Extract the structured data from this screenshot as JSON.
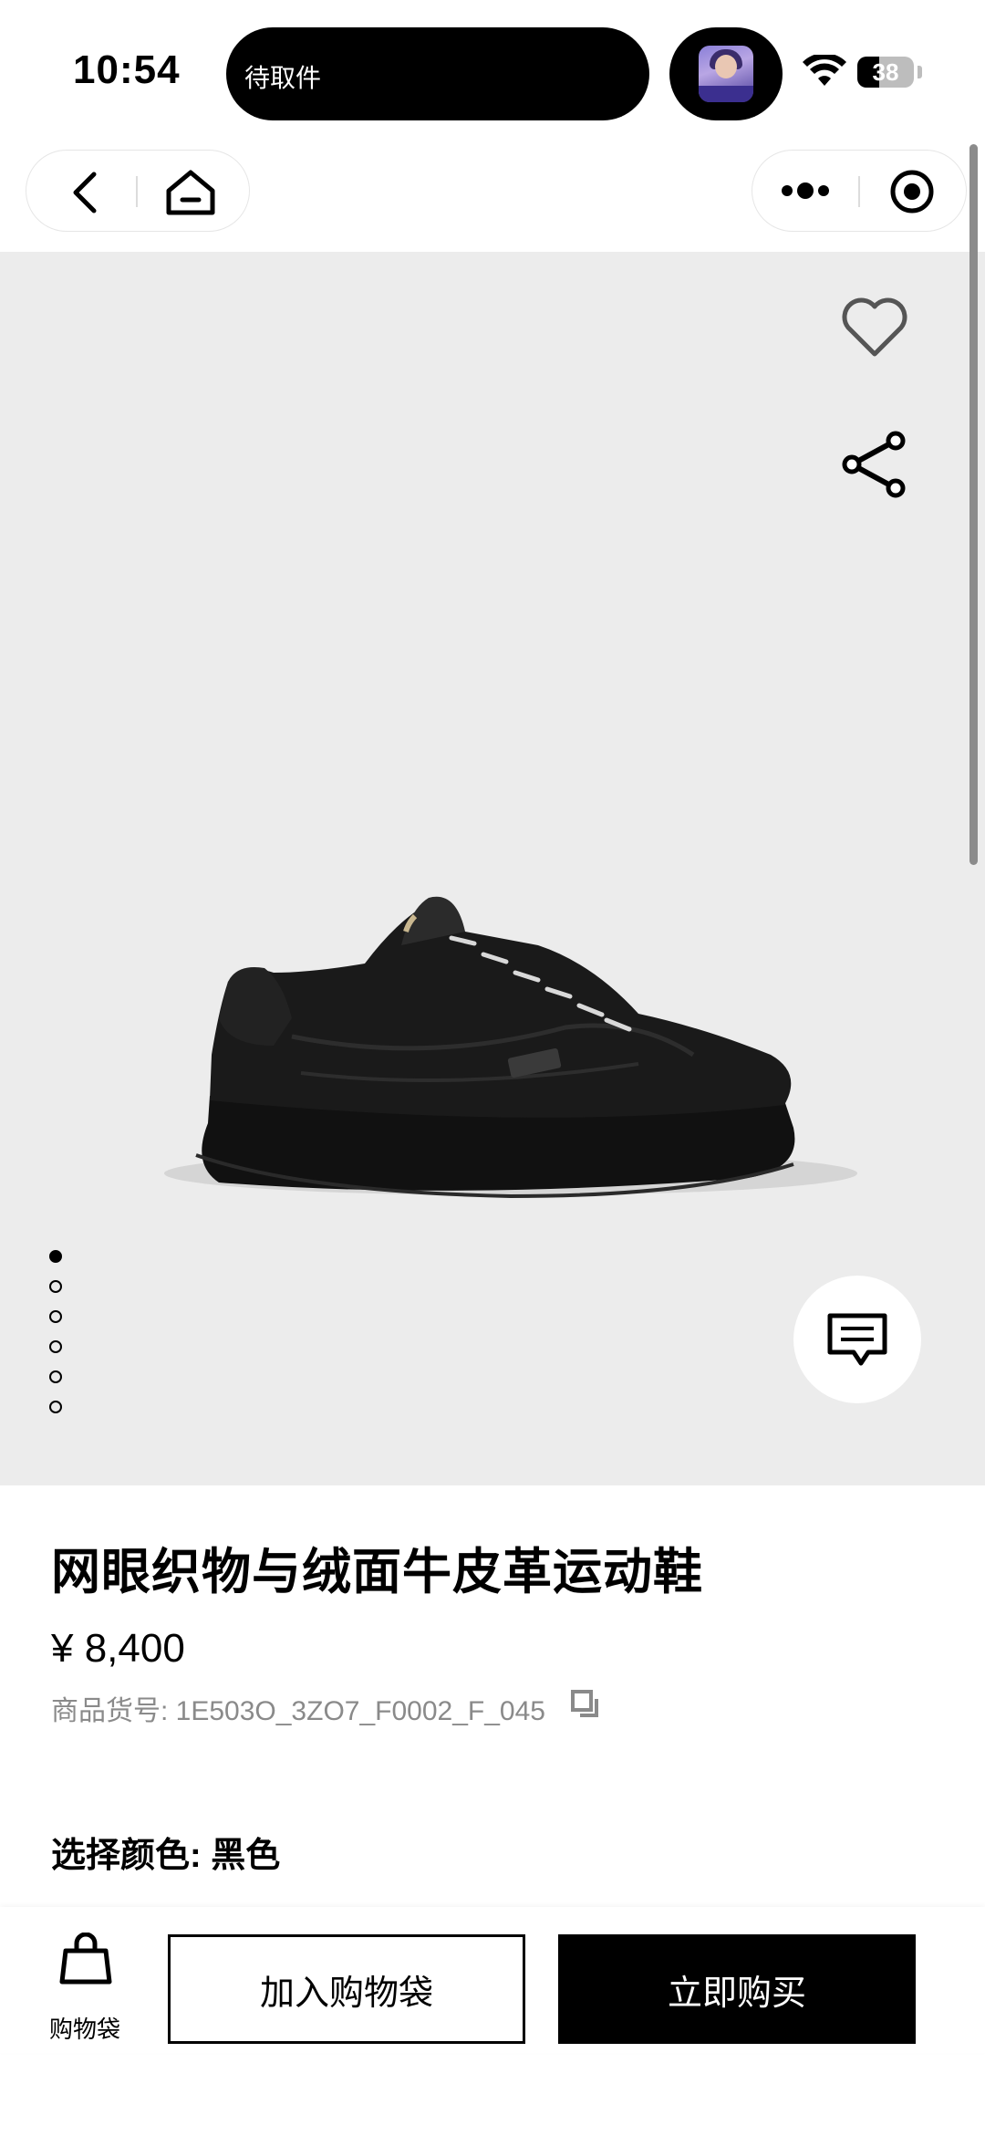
{
  "status_bar": {
    "time": "10:54",
    "live_activity": "待取件",
    "battery": "38",
    "battery_level": 0.38
  },
  "nav": {
    "back_icon": "chevron-left-icon",
    "home_icon": "home-icon",
    "more_icon": "more-dots-icon",
    "close_icon": "target-circle-icon"
  },
  "hero": {
    "image_alt": "black sneaker product photo",
    "favorite_icon": "heart-icon",
    "share_icon": "share-icon",
    "chat_icon": "chat-bubble-icon",
    "page_count": 6,
    "active_page": 0,
    "background": "#ececec"
  },
  "product": {
    "title": "网眼织物与绒面牛皮革运动鞋",
    "price": "¥ 8,400",
    "sku": "商品货号: 1E503O_3ZO7_F0002_F_045",
    "color_label": "选择颜色: 黑色"
  },
  "bottom_bar": {
    "bag_label": "购物袋",
    "add_to_bag": "加入购物袋",
    "buy_now": "立即购买"
  },
  "colors": {
    "accent": "#000000",
    "muted_text": "#8a8a8a"
  }
}
